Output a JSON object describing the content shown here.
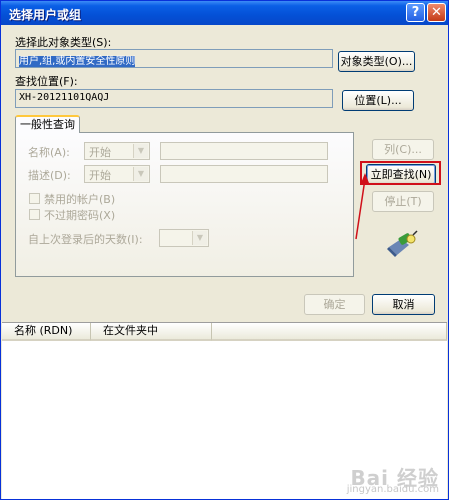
{
  "window": {
    "title": "选择用户或组",
    "help_glyph": "?",
    "close_glyph": "✕"
  },
  "object_type": {
    "label": "选择此对象类型(S):",
    "value": "用户,组,或内置安全性原则",
    "button": "对象类型(O)..."
  },
  "location": {
    "label": "查找位置(F):",
    "value": "XH-20121101QAQJ",
    "button": "位置(L)..."
  },
  "query_tab": {
    "label": "一般性查询",
    "name_label": "名称(A):",
    "name_mode": "开始",
    "desc_label": "描述(D):",
    "desc_mode": "开始",
    "disabled_accounts": "禁用的帐户(B)",
    "no_expire_pwd": "不过期密码(X)",
    "days_since_login": "自上次登录后的天数(I):"
  },
  "side_buttons": {
    "columns": "列(C)...",
    "find_now": "立即查找(N)",
    "stop": "停止(T)"
  },
  "dialog_buttons": {
    "ok": "确定",
    "cancel": "取消"
  },
  "results": {
    "columns": [
      "名称 (RDN)",
      "在文件夹中"
    ]
  },
  "watermark": {
    "logo": "Bai 经验",
    "url": "jingyan.baidu.com"
  },
  "colors": {
    "highlight": "#d0101a",
    "selection": "#316ac5",
    "titlebar": "#0450d6"
  }
}
